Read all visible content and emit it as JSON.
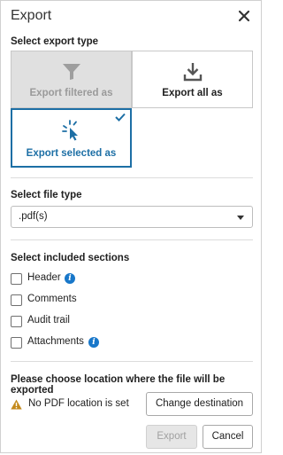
{
  "dialog": {
    "title": "Export",
    "close_icon": "close-icon"
  },
  "export_type": {
    "label": "Select export type",
    "options": [
      {
        "label": "Export filtered as",
        "icon": "filter-icon",
        "state": "disabled"
      },
      {
        "label": "Export all as",
        "icon": "download-icon",
        "state": "normal"
      },
      {
        "label": "Export selected as",
        "icon": "cursor-click-icon",
        "state": "selected"
      }
    ],
    "selected_marker": "checkmark-icon",
    "accent_color": "#1d6fa5"
  },
  "file_type": {
    "label": "Select file type",
    "value": ".pdf(s)"
  },
  "sections": {
    "label": "Select included sections",
    "items": [
      {
        "label": "Header",
        "checked": false,
        "has_info": true
      },
      {
        "label": "Comments",
        "checked": false,
        "has_info": false
      },
      {
        "label": "Audit trail",
        "checked": false,
        "has_info": false
      },
      {
        "label": "Attachments",
        "checked": false,
        "has_info": true
      }
    ],
    "info_glyph": "i",
    "info_color": "#1877c9"
  },
  "location": {
    "prompt": "Please choose location where the file will be exported",
    "warning_text": "No PDF location is set",
    "warning_icon": "warning-icon",
    "warning_color": "#c48a1c",
    "change_button": "Change destination"
  },
  "footer": {
    "export_button": "Export",
    "export_disabled": true,
    "cancel_button": "Cancel"
  }
}
